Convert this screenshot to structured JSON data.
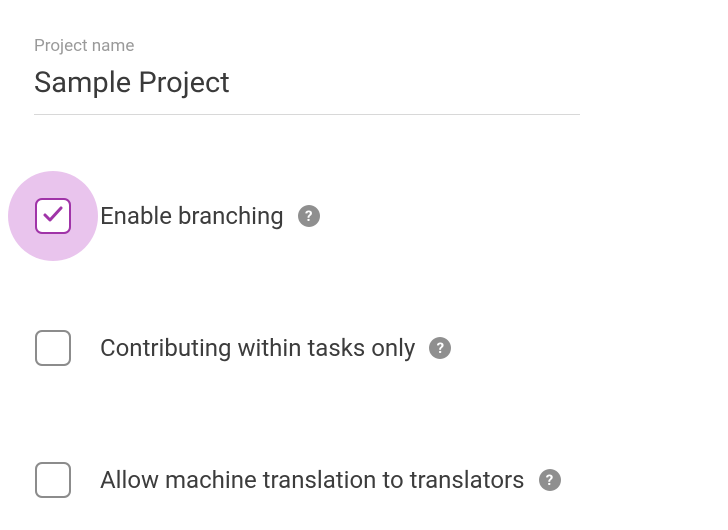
{
  "projectName": {
    "label": "Project name",
    "value": "Sample Project"
  },
  "options": [
    {
      "label": "Enable branching",
      "checked": true,
      "highlighted": true
    },
    {
      "label": "Contributing within tasks only",
      "checked": false,
      "highlighted": false
    },
    {
      "label": "Allow machine translation to translators",
      "checked": false,
      "highlighted": false
    }
  ],
  "helpGlyph": "?"
}
